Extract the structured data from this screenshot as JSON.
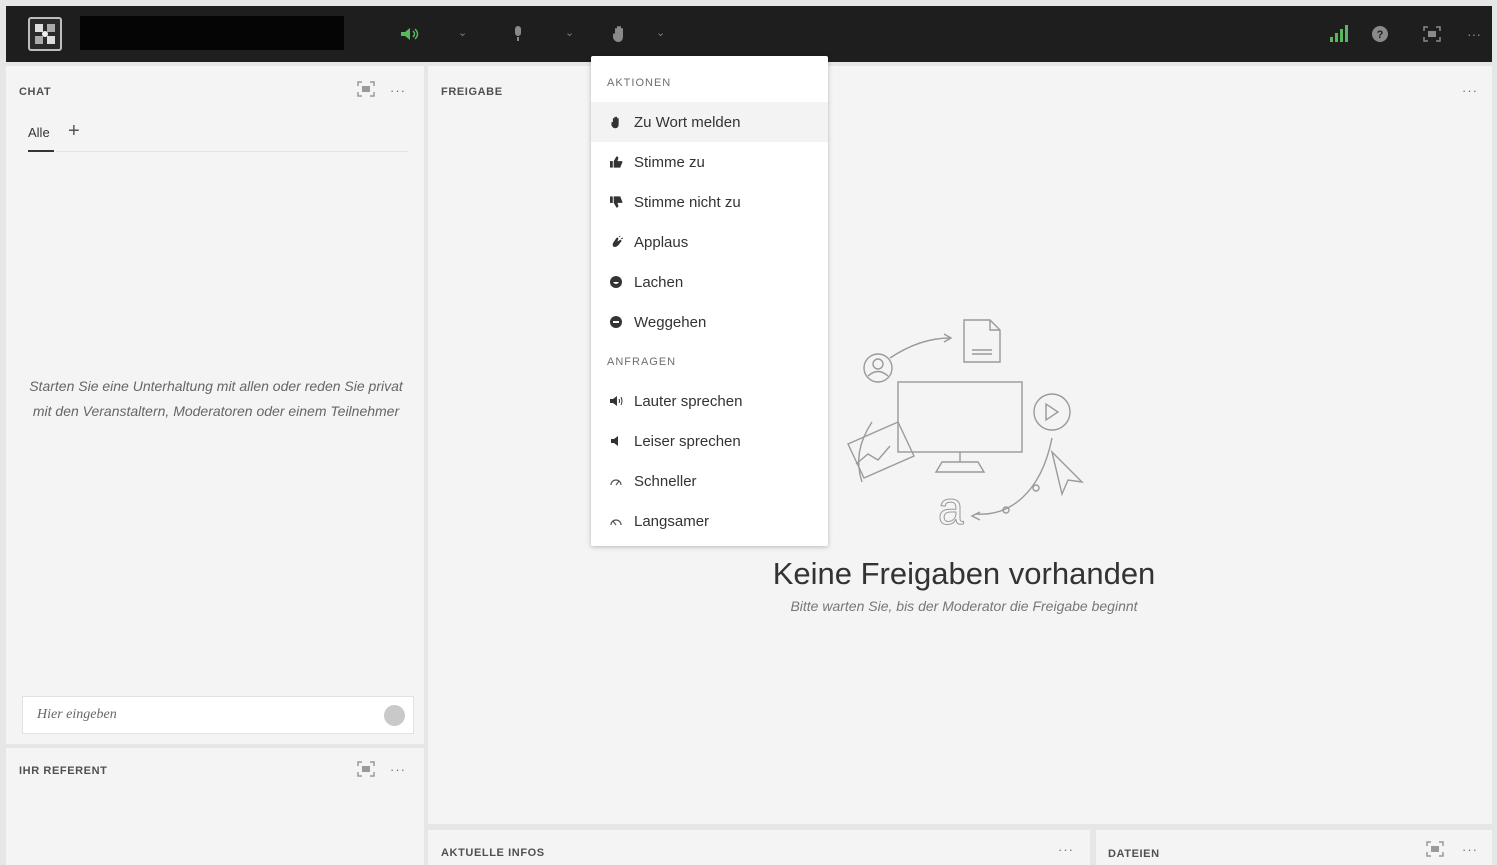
{
  "topbar": {
    "meeting_name": "",
    "colors": {
      "bar": "#1e1e1e",
      "speaker_active": "#58b85c",
      "signal": "#58b85c"
    },
    "icons": [
      "speaker-icon",
      "chevron-down-icon",
      "microphone-icon",
      "hand-icon",
      "signal-icon",
      "help-icon",
      "fullscreen-icon",
      "more-icon"
    ]
  },
  "chat": {
    "title": "CHAT",
    "tab": "Alle",
    "empty_message": "Starten Sie eine Unterhaltung mit allen oder reden Sie privat mit den Veranstaltern, Moderatoren oder einem Teilnehmer",
    "input_placeholder": "Hier eingeben"
  },
  "referent": {
    "title": "IHR REFERENT"
  },
  "share": {
    "title": "FREIGABE",
    "empty_title": "Keine Freigaben vorhanden",
    "empty_sub": "Bitte warten Sie, bis der Moderator die Freigabe beginnt"
  },
  "news": {
    "title": "AKTUELLE INFOS"
  },
  "files": {
    "title": "DATEIEN"
  },
  "menu": {
    "section_actions": "AKTIONEN",
    "actions": [
      {
        "label": "Zu Wort melden",
        "icon": "hand-icon"
      },
      {
        "label": "Stimme zu",
        "icon": "thumbs-up-icon"
      },
      {
        "label": "Stimme nicht zu",
        "icon": "thumbs-down-icon"
      },
      {
        "label": "Applaus",
        "icon": "applause-icon"
      },
      {
        "label": "Lachen",
        "icon": "laugh-icon"
      },
      {
        "label": "Weggehen",
        "icon": "away-icon"
      }
    ],
    "section_requests": "ANFRAGEN",
    "requests": [
      {
        "label": "Lauter sprechen",
        "icon": "volume-up-icon"
      },
      {
        "label": "Leiser sprechen",
        "icon": "volume-down-icon"
      },
      {
        "label": "Schneller",
        "icon": "speed-up-icon"
      },
      {
        "label": "Langsamer",
        "icon": "slow-down-icon"
      }
    ]
  }
}
